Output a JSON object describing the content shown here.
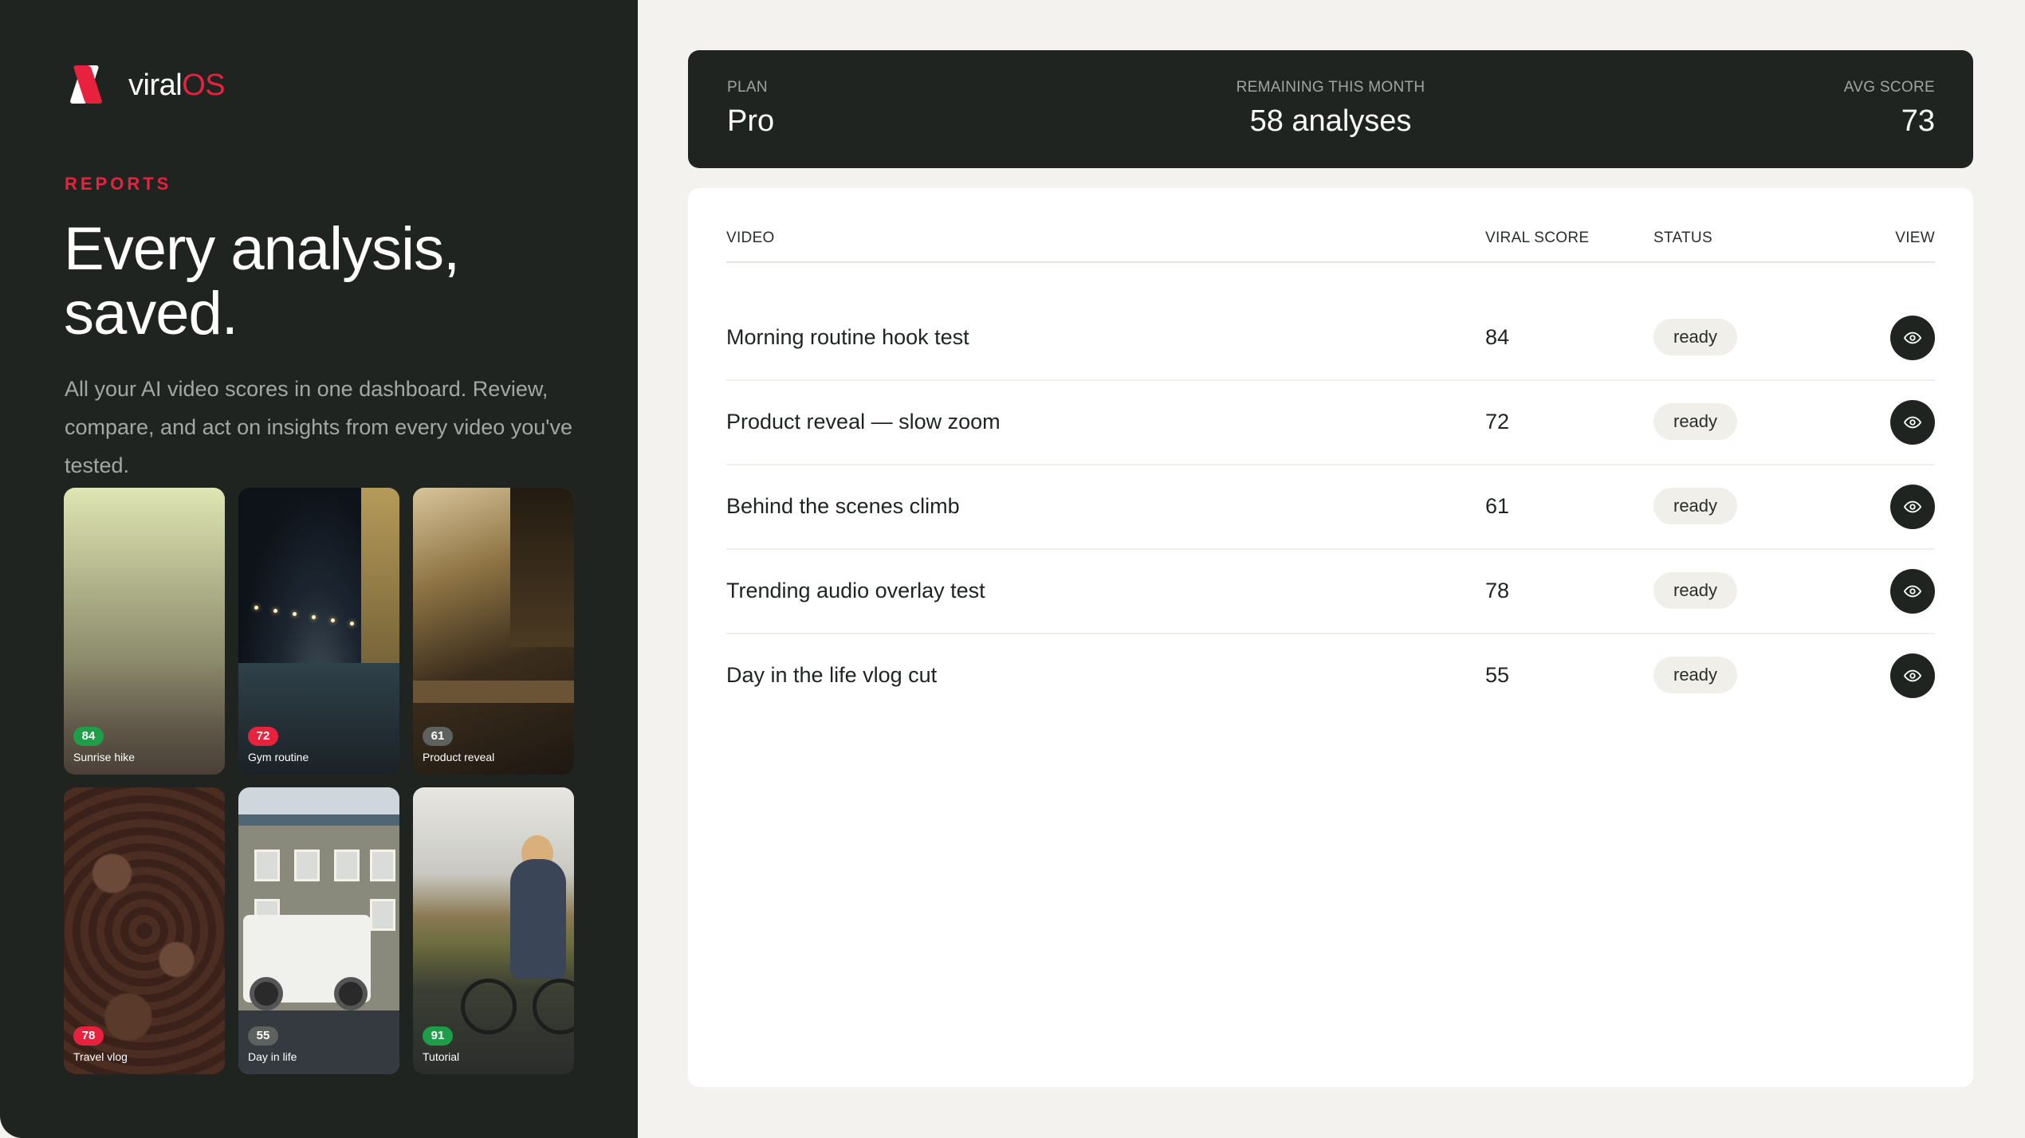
{
  "brand": {
    "name_main": "viral",
    "name_accent": "OS"
  },
  "hero": {
    "eyebrow": "REPORTS",
    "title_line1": "Every analysis,",
    "title_line2": "saved.",
    "description": "All your AI video scores in one dashboard. Review, compare, and act on insights from every video you've tested."
  },
  "thumbnails": [
    {
      "score": "84",
      "caption": "Sunrise hike",
      "badge_color": "#1f9d49"
    },
    {
      "score": "72",
      "caption": "Gym routine",
      "badge_color": "#e8213f"
    },
    {
      "score": "61",
      "caption": "Product reveal",
      "badge_color": "#5d625f"
    },
    {
      "score": "78",
      "caption": "Travel vlog",
      "badge_color": "#e8213f"
    },
    {
      "score": "55",
      "caption": "Day in life",
      "badge_color": "#5d625f"
    },
    {
      "score": "91",
      "caption": "Tutorial",
      "badge_color": "#1f9d49"
    }
  ],
  "stats": {
    "plan_label": "PLAN",
    "plan_value": "Pro",
    "remaining_label": "REMAINING THIS MONTH",
    "remaining_value": "58 analyses",
    "avg_label": "AVG SCORE",
    "avg_value": "73"
  },
  "table": {
    "headers": {
      "video": "VIDEO",
      "score": "VIRAL SCORE",
      "status": "STATUS",
      "view": "VIEW"
    },
    "rows": [
      {
        "name": "Morning routine hook test",
        "score": "84",
        "status": "ready"
      },
      {
        "name": "Product reveal — slow zoom",
        "score": "72",
        "status": "ready"
      },
      {
        "name": "Behind the scenes climb",
        "score": "61",
        "status": "ready"
      },
      {
        "name": "Trending audio overlay test",
        "score": "78",
        "status": "ready"
      },
      {
        "name": "Day in the life vlog cut",
        "score": "55",
        "status": "ready"
      }
    ]
  },
  "colors": {
    "accent": "#e8213f",
    "dark": "#1f2421",
    "good": "#1f9d49"
  }
}
